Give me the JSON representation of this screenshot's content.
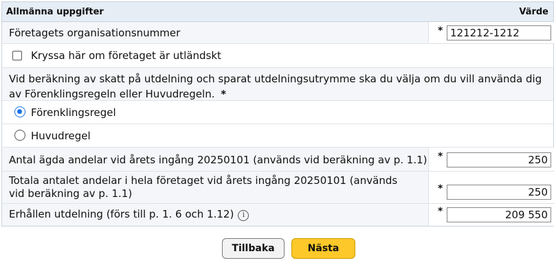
{
  "header": {
    "title": "Allmänna uppgifter",
    "value_col": "Värde"
  },
  "orgnr": {
    "label": "Företagets organisationsnummer",
    "required": "*",
    "value": "121212-1212"
  },
  "foreign_checkbox": {
    "label": "Kryssa här om företaget är utländskt",
    "checked": false
  },
  "rule_question": {
    "text": "Vid beräkning av skatt på utdelning och sparat utdelningsutrymme ska du välja om du vill använda dig av Förenklingsregeln eller Huvudregeln.",
    "required": "*"
  },
  "rule_options": [
    {
      "label": "Förenklingsregel",
      "selected": true
    },
    {
      "label": "Huvudregel",
      "selected": false
    }
  ],
  "shares_owned": {
    "label": "Antal ägda andelar vid årets ingång 20250101 (används vid beräkning av p. 1.1)",
    "required": "*",
    "value": "250"
  },
  "shares_total": {
    "label": "Totala antalet andelar i hela företaget vid årets ingång 20250101 (används vid beräkning av p. 1.1)",
    "required": "*",
    "value": "250"
  },
  "dividend": {
    "label": "Erhållen utdelning (förs till p. 1. 6 och 1.12)",
    "info_icon": "i",
    "required": "*",
    "value": "209 550"
  },
  "buttons": {
    "back": "Tillbaka",
    "next": "Nästa"
  },
  "colors": {
    "header_bg": "#e6edf5",
    "next_button": "#fdc829",
    "radio_accent": "#1a73e8"
  }
}
